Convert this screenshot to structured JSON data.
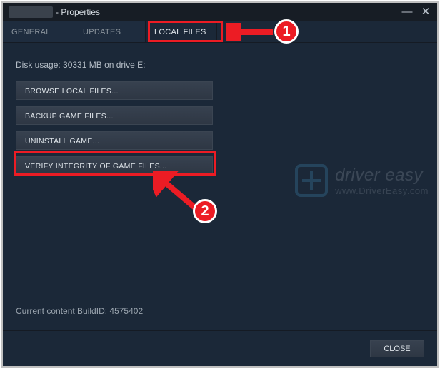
{
  "window": {
    "title_suffix": "- Properties",
    "minimize": "—",
    "close": "✕"
  },
  "tabs": {
    "general": "GENERAL",
    "updates": "UPDATES",
    "local_files": "LOCAL FILES"
  },
  "content": {
    "disk_usage": "Disk usage: 30331 MB on drive E:",
    "browse": "BROWSE LOCAL FILES...",
    "backup": "BACKUP GAME FILES...",
    "uninstall": "UNINSTALL GAME...",
    "verify": "VERIFY INTEGRITY OF GAME FILES...",
    "build_id": "Current content BuildID: 4575402"
  },
  "footer": {
    "close": "CLOSE"
  },
  "watermark": {
    "line1": "driver easy",
    "line2": "www.DriverEasy.com"
  },
  "annotations": {
    "step1": "1",
    "step2": "2"
  }
}
